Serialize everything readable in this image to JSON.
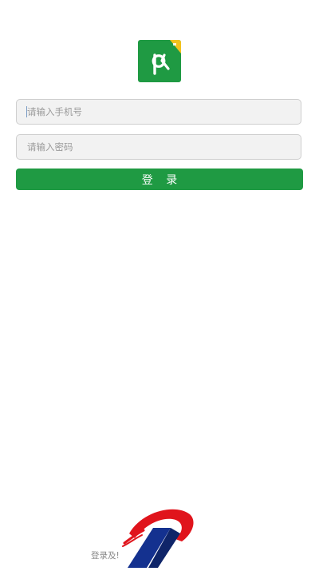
{
  "app": {
    "logo_icon": "pk-app-logo-icon",
    "brand_color": "#1f9a43"
  },
  "login_form": {
    "phone_placeholder": "请输入手机号",
    "phone_value": "",
    "password_placeholder": "请输入密码",
    "password_value": "",
    "submit_label": "登 录"
  },
  "footer": {
    "text": "登录及!",
    "brand_logo_icon": "red-blue-swoosh-logo-icon"
  }
}
